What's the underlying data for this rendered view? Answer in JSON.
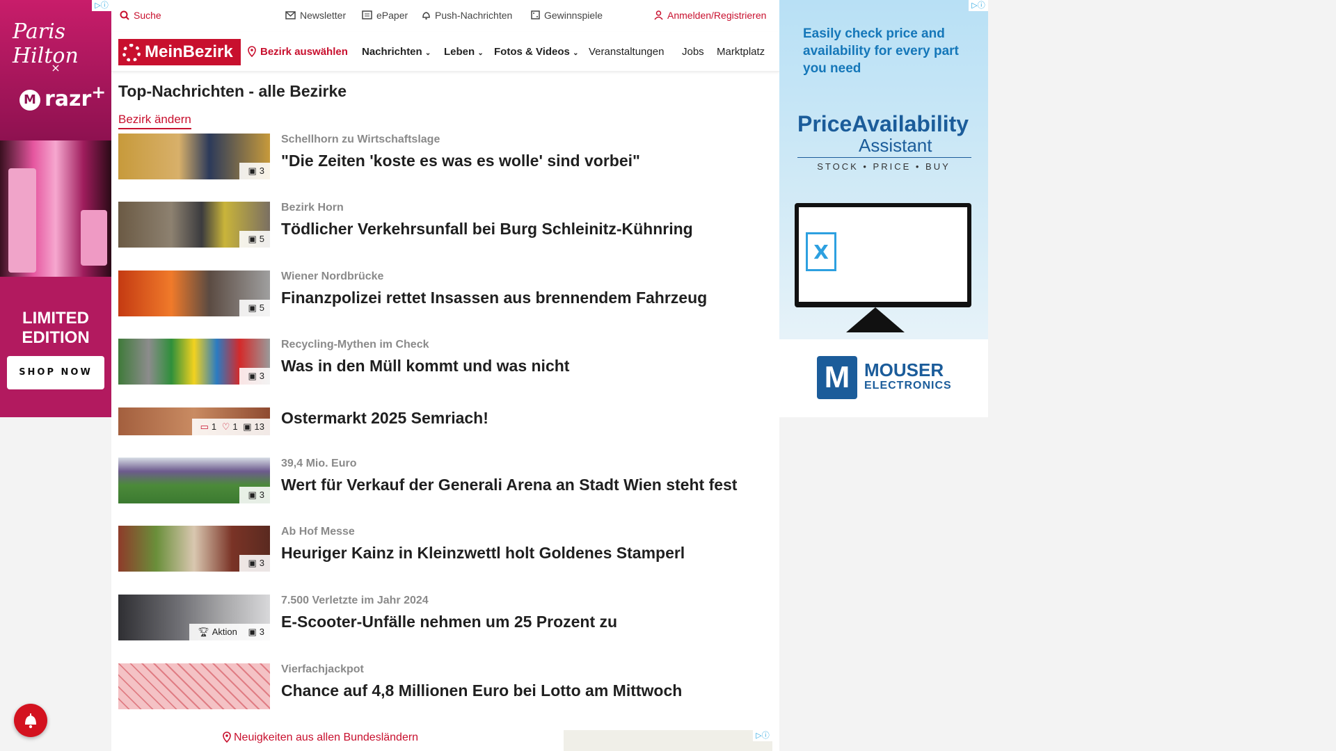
{
  "left_ad": {
    "signature": "Paris Hilton",
    "x": "×",
    "brand": "razr",
    "brand_sup": "+",
    "limited": "LIMITED EDITION",
    "cta": "SHOP NOW"
  },
  "topbar": {
    "search": "Suche",
    "newsletter": "Newsletter",
    "epaper": "ePaper",
    "push": "Push-Nachrichten",
    "gewinnspiele": "Gewinnspiele",
    "login": "Anmelden/Registrieren"
  },
  "nav": {
    "logo": "MeinBezirk",
    "select_district": "Bezirk auswählen",
    "items": [
      "Nachrichten",
      "Leben",
      "Fotos & Videos",
      "Veranstaltungen",
      "Jobs",
      "Marktplatz"
    ]
  },
  "page": {
    "title": "Top-Nachrichten - alle Bezirke",
    "change_district": "Bezirk ändern"
  },
  "articles": [
    {
      "kicker": "Schellhorn zu Wirtschaftslage",
      "headline": "\"Die Zeiten 'koste es was es wolle' sind vorbei\"",
      "images": "3",
      "color": "#c79a3b"
    },
    {
      "kicker": "Bezirk Horn",
      "headline": "Tödlicher Verkehrsunfall bei Burg Schleinitz-Kühnring",
      "images": "5",
      "color": "#7a6f62"
    },
    {
      "kicker": "Wiener Nordbrücke",
      "headline": "Finanzpolizei rettet Insassen aus brennendem Fahrzeug",
      "images": "5",
      "color": "#d4501e"
    },
    {
      "kicker": "Recycling-Mythen im Check",
      "headline": "Was in den Müll kommt und was nicht",
      "images": "3",
      "color": "#4f8a3a"
    },
    {
      "kicker": "",
      "headline": "Ostermarkt 2025 Semriach!",
      "comments": "1",
      "likes": "1",
      "images": "13",
      "color": "#b5704a"
    },
    {
      "kicker": "39,4 Mio. Euro",
      "headline": "Wert für Verkauf der Generali Arena an Stadt Wien steht fest",
      "images": "3",
      "color": "#4d7d3c"
    },
    {
      "kicker": "Ab Hof Messe",
      "headline": "Heuriger Kainz in Kleinzwettl holt Goldenes Stamperl",
      "images": "3",
      "color": "#8e3b2a"
    },
    {
      "kicker": "7.500 Verletzte im Jahr 2024",
      "headline": "E-Scooter-Unfälle nehmen um 25 Prozent zu",
      "action": "Aktion",
      "images": "3",
      "color": "#5f5f63"
    },
    {
      "kicker": "Vierfachjackpot",
      "headline": "Chance auf 4,8 Millionen Euro bei Lotto am Mittwoch",
      "color": "#e79a9f"
    }
  ],
  "footer": {
    "all_states": "Neuigkeiten aus allen Bundesländern"
  },
  "right_ad": {
    "headline": "Easily check price and availability for every part you need",
    "product": "PriceAvailability",
    "product_sub": "Assistant",
    "tagline": "STOCK • PRICE • BUY",
    "brand": "MOUSER",
    "brand_sub": "ELECTRONICS"
  },
  "icons": {
    "adchoice": "▷ⓘ",
    "bell": "🔔"
  }
}
